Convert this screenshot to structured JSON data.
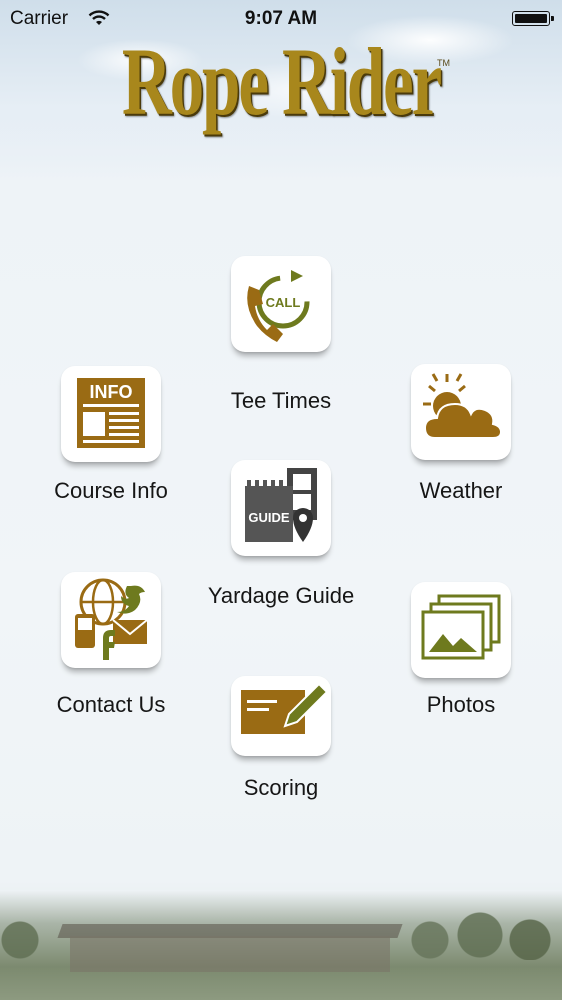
{
  "status_bar": {
    "carrier": "Carrier",
    "time": "9:07 AM"
  },
  "app": {
    "logo_text": "Rope Rider",
    "trademark": "TM"
  },
  "menu": {
    "tee_times": "Tee Times",
    "course_info": "Course Info",
    "weather": "Weather",
    "yardage_guide": "Yardage Guide",
    "contact_us": "Contact Us",
    "photos": "Photos",
    "scoring": "Scoring"
  },
  "icon_text": {
    "call": "CALL",
    "info": "INFO",
    "guide": "GUIDE"
  },
  "colors": {
    "brand_gold": "#a8871c",
    "icon_brown": "#9a6b14",
    "icon_green": "#6e7a1e"
  }
}
